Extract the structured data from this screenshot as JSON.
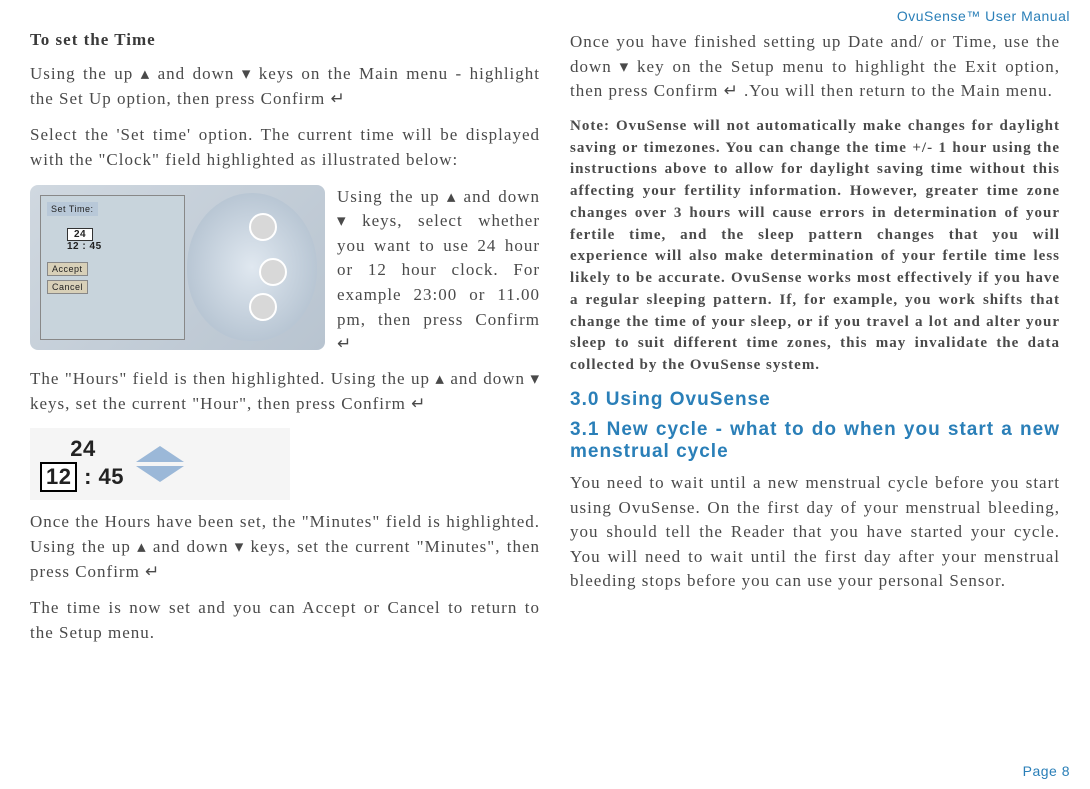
{
  "header": {
    "product": "OvuSense™ User Manual"
  },
  "left": {
    "title": "To set the Time",
    "p1": "Using the up ▴ and down ▾ keys on the Main menu - highlight the Set Up option, then press Confirm ↵",
    "p2": "Select the 'Set time' option. The current time will be displayed with the \"Clock\" field highlighted as illustrated below:",
    "device_side": "Using the up ▴ and down ▾ keys, select whether you want to use 24 hour or 12 hour clock. For example 23:00 or 11.00 pm, then press Confirm ↵",
    "screen": {
      "title": "Set Time:",
      "twentyfour": "24",
      "time": "12 : 45",
      "accept": "Accept",
      "cancel": "Cancel"
    },
    "p3": "The \"Hours\" field is then highlighted. Using the up ▴ and down ▾ keys, set the current \"Hour\", then press Confirm ↵",
    "editor": {
      "line1": "24",
      "line2a": "12",
      "line2b": " : 45"
    },
    "p4": "Once the Hours have been set, the \"Minutes\" field is highlighted. Using the up ▴ and down ▾ keys, set the current \"Minutes\", then press Confirm ↵",
    "p5": "The time is now set and you can Accept or Cancel to return to the Setup menu."
  },
  "right": {
    "p1": "Once you have finished setting up Date and/ or Time, use the down ▾ key on the Setup menu to highlight the Exit option, then press Confirm ↵ .You will then return to the Main menu.",
    "note": "Note: OvuSense will not automatically make changes for daylight saving or timezones. You can change the time +/- 1 hour using the instructions above to allow for daylight saving time without this affecting your fertility information. However, greater time zone changes over 3 hours will cause errors in determination of your fertile time, and the sleep pattern changes that you will experience will also make determination of your fertile time less likely to be accurate. OvuSense works most effectively if you have a regular sleeping pattern. If, for example, you work shifts that change the time of your sleep, or if you travel a lot and alter your sleep to suit different time zones, this may invalidate the data collected by the OvuSense system.",
    "h1": "3.0 Using OvuSense",
    "h2": "3.1 New cycle - what to do when you start a new menstrual cycle",
    "p2": "You need to wait until a new menstrual cycle before you start using OvuSense. On the first day of your menstrual bleeding, you should tell the Reader that you have started your cycle. You will need to wait until the first day after your menstrual bleeding stops before you can use your personal Sensor."
  },
  "footer": {
    "page": "Page 8"
  }
}
